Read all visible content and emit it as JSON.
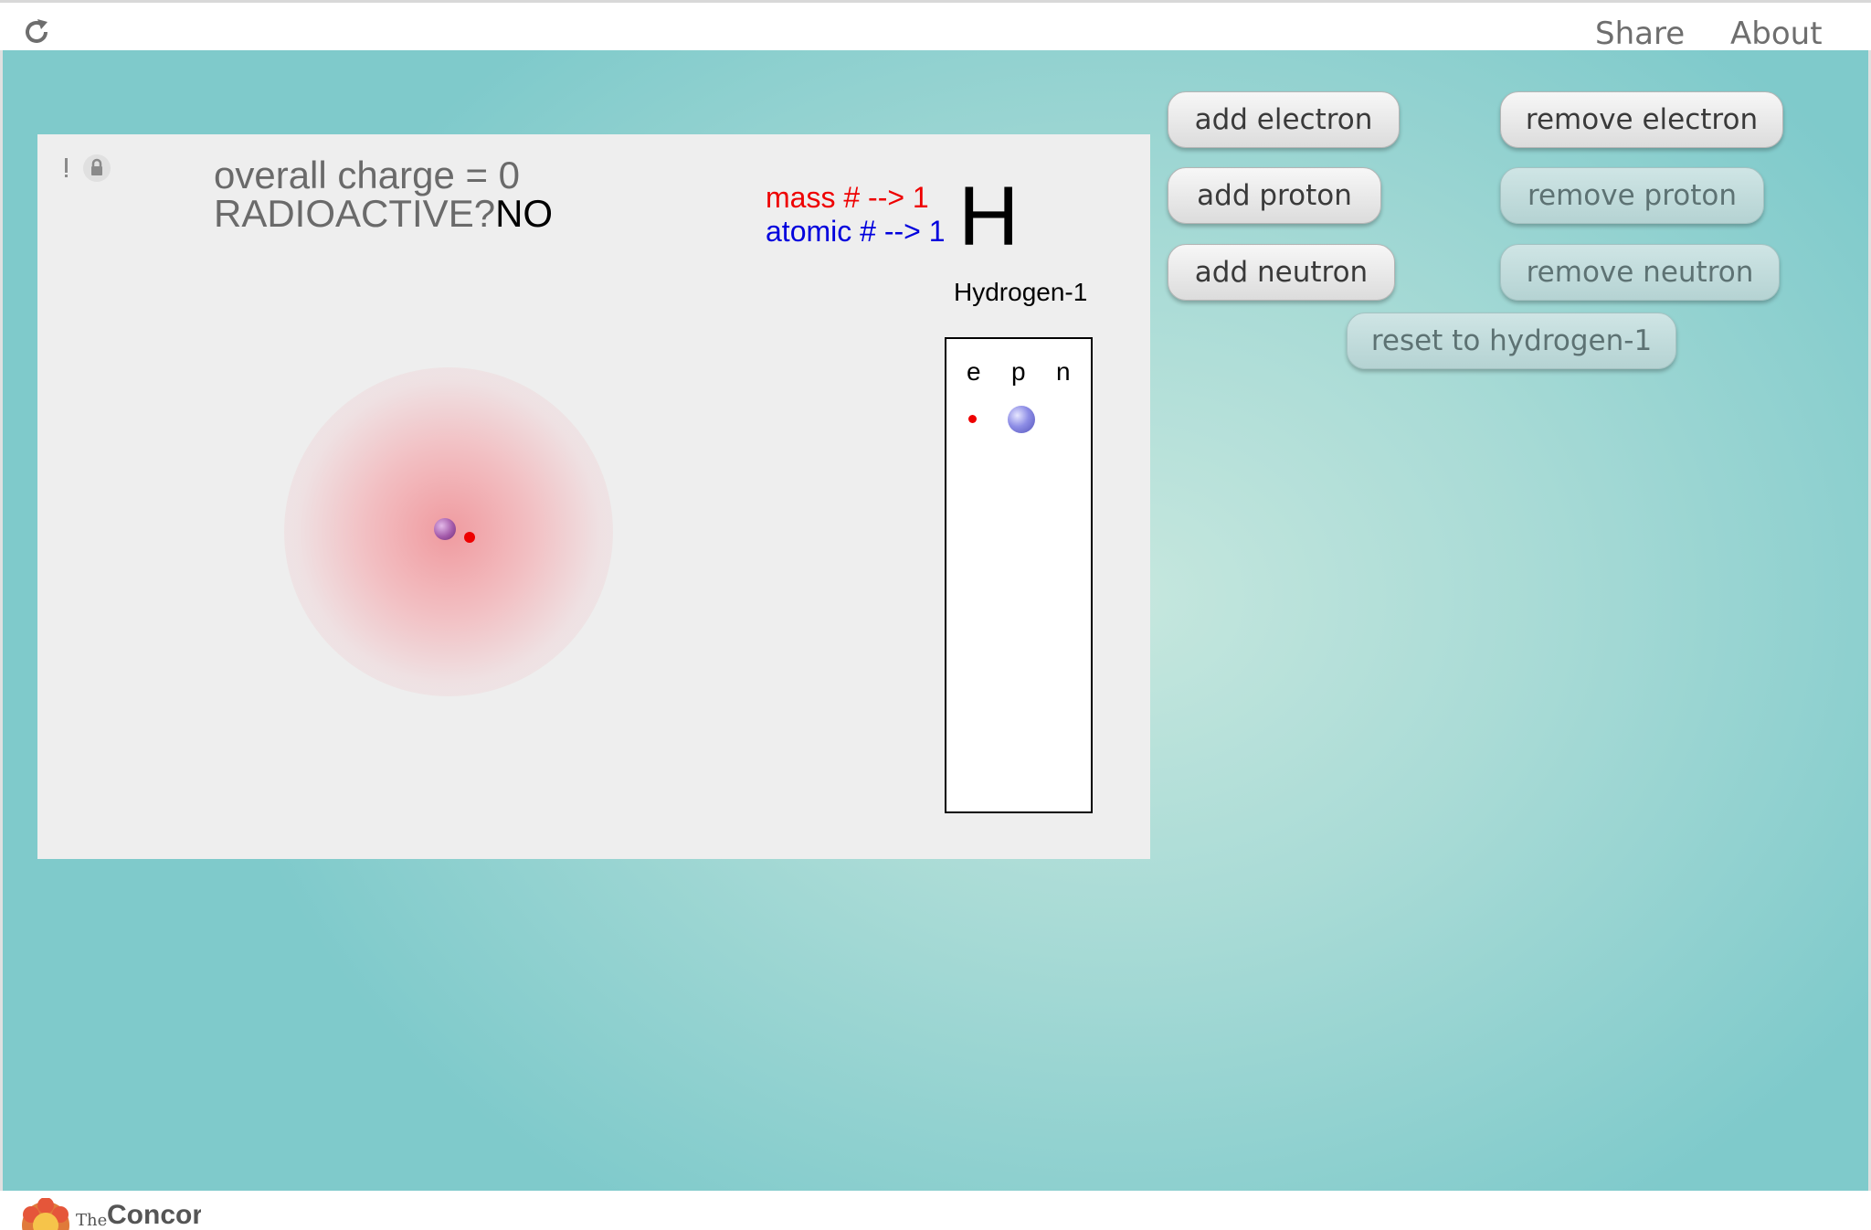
{
  "topbar": {
    "reload_icon": "reload-icon",
    "share_label": "Share",
    "about_label": "About"
  },
  "sim": {
    "charge_text": "overall charge = 0",
    "radioactive_label": "RADIOACTIVE?",
    "radioactive_value": "NO",
    "mass_text": "mass # --> 1",
    "atomic_text": "atomic # --> 1",
    "element_symbol": "H",
    "isotope_name": "Hydrogen-1",
    "table_headers": [
      "e",
      "p",
      "n"
    ],
    "counts": {
      "electrons": 1,
      "protons": 1,
      "neutrons": 0
    }
  },
  "buttons": {
    "add_electron": "add electron",
    "remove_electron": "remove electron",
    "add_proton": "add proton",
    "remove_proton": "remove proton",
    "add_neutron": "add neutron",
    "remove_neutron": "remove neutron",
    "reset": "reset to hydrogen-1"
  },
  "footer": {
    "logo_small": "The",
    "logo_word": "Concord"
  },
  "colors": {
    "mass": "#ee0000",
    "atomic": "#0000dd",
    "electron": "#ee0000",
    "proton": "#8e8ee6",
    "background_teal": "#7fcacb"
  }
}
